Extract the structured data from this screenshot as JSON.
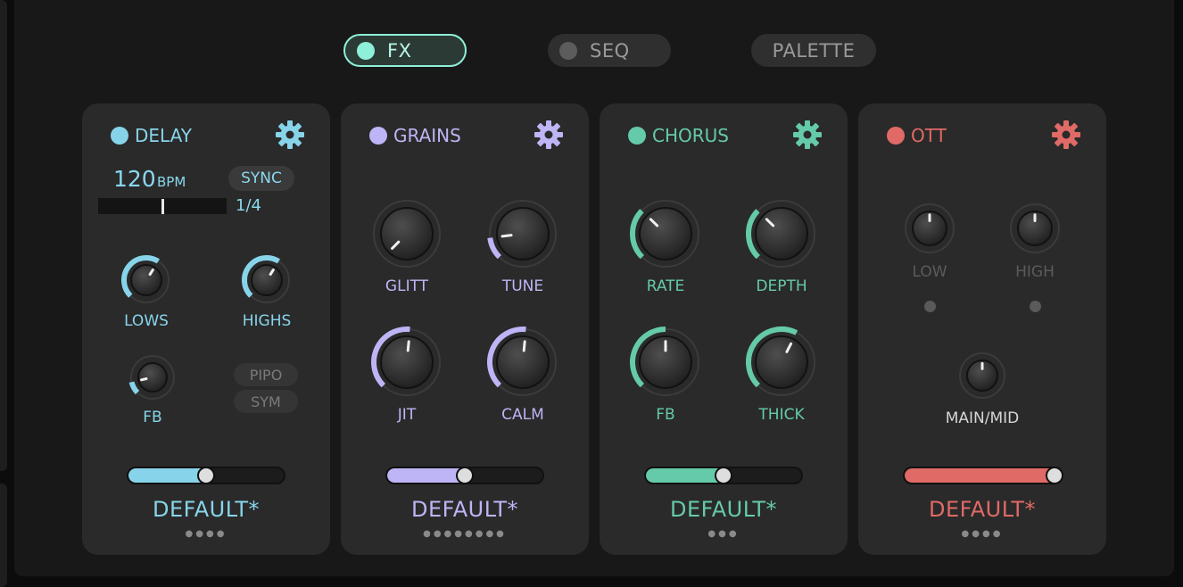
{
  "tabs": [
    {
      "label": "FX",
      "active": true
    },
    {
      "label": "SEQ",
      "active": false
    },
    {
      "label": "PALETTE",
      "active": false
    }
  ],
  "colors": {
    "delay": "#87d4ea",
    "grains": "#bdb5f5",
    "chorus": "#65caa9",
    "ott": "#e06a66"
  },
  "panels": {
    "delay": {
      "title": "DELAY",
      "bpm_value": "120",
      "bpm_unit": "BPM",
      "sync_label": "SYNC",
      "time_value": "1/4",
      "time_position": 0.5,
      "knobs": [
        {
          "label": "LOWS",
          "value": 0.62
        },
        {
          "label": "HIGHS",
          "value": 0.62
        },
        {
          "label": "FB",
          "value": 0.12
        }
      ],
      "toggles": [
        "PIPO",
        "SYM"
      ],
      "mix": 0.5,
      "preset": "DEFAULT*",
      "preset_dots": "●●●●"
    },
    "grains": {
      "title": "GRAINS",
      "knobs": [
        {
          "label": "GLITT",
          "value": 0.0
        },
        {
          "label": "TUNE",
          "value": 0.14
        },
        {
          "label": "JIT",
          "value": 0.52
        },
        {
          "label": "CALM",
          "value": 0.52
        }
      ],
      "mix": 0.5,
      "preset": "DEFAULT*",
      "preset_dots": "●●●●●●●●"
    },
    "chorus": {
      "title": "CHORUS",
      "knobs": [
        {
          "label": "RATE",
          "value": 0.33
        },
        {
          "label": "DEPTH",
          "value": 0.33
        },
        {
          "label": "FB",
          "value": 0.5
        },
        {
          "label": "THICK",
          "value": 0.6
        }
      ],
      "mix": 0.5,
      "preset": "DEFAULT*",
      "preset_dots": "●●●"
    },
    "ott": {
      "title": "OTT",
      "knobs": [
        {
          "label": "LOW",
          "value": 0.5
        },
        {
          "label": "HIGH",
          "value": 0.5
        },
        {
          "label": "MAIN/MID",
          "value": 0.5
        }
      ],
      "mix": 1.0,
      "preset": "DEFAULT*",
      "preset_dots": "●●●●"
    }
  }
}
